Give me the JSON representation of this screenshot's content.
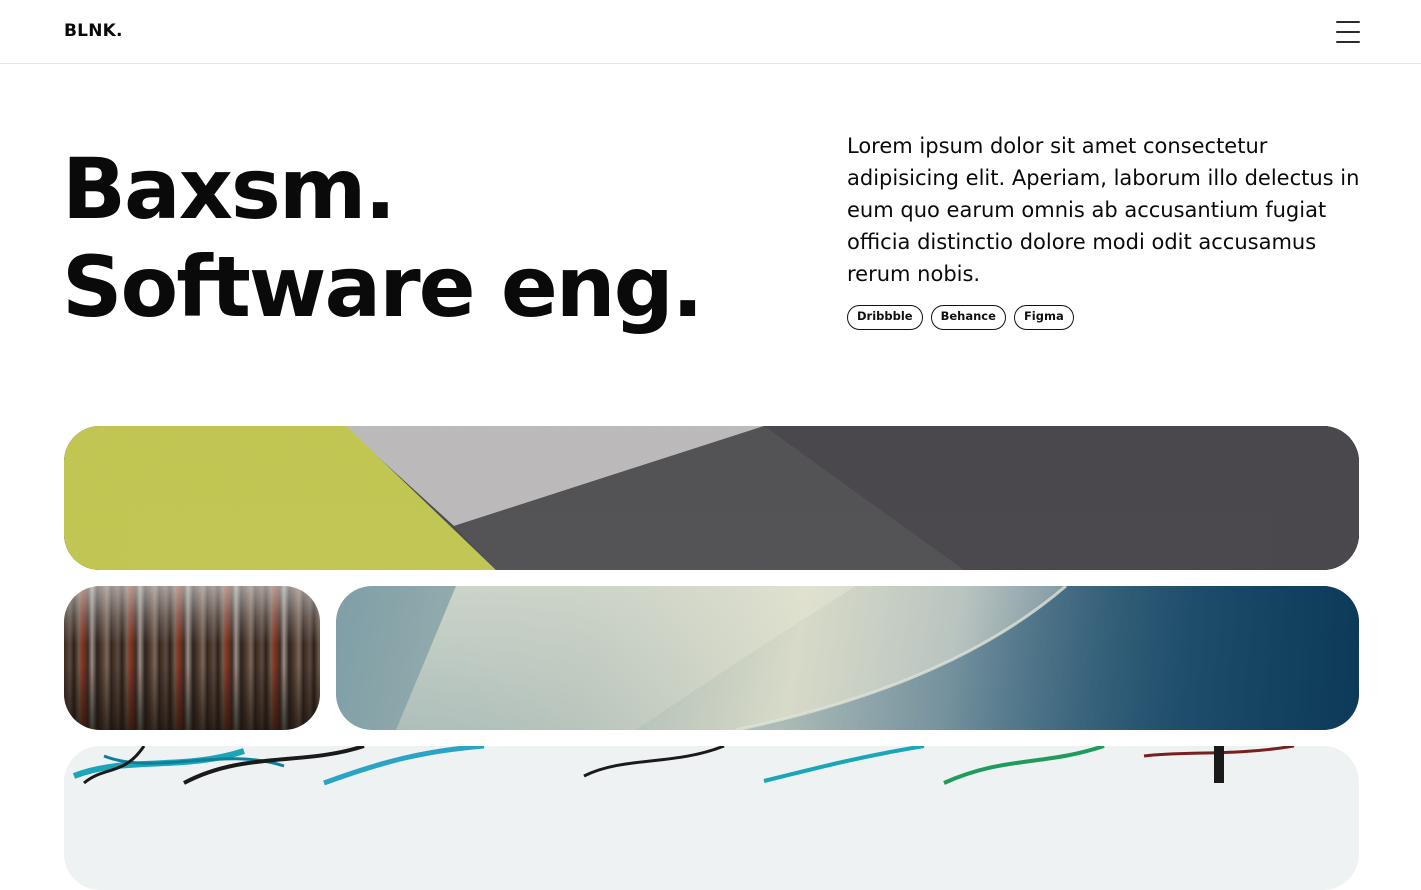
{
  "header": {
    "brand": "BLNK.",
    "menu_icon": "hamburger-menu-icon"
  },
  "hero": {
    "title_line_1": "Baxsm.",
    "title_line_2": "Software eng.",
    "description": "Lorem ipsum dolor sit amet consectetur adipisicing elit. Aperiam, laborum illo delectus in eum quo earum omnis ab accusantium fugiat officia distinctio dolore modi odit accusamus rerum nobis.",
    "links": [
      "Dribbble",
      "Behance",
      "Figma"
    ]
  },
  "colors": {
    "text": "#0a0a0a",
    "background": "#ffffff",
    "divider": "#e6e6e6"
  }
}
